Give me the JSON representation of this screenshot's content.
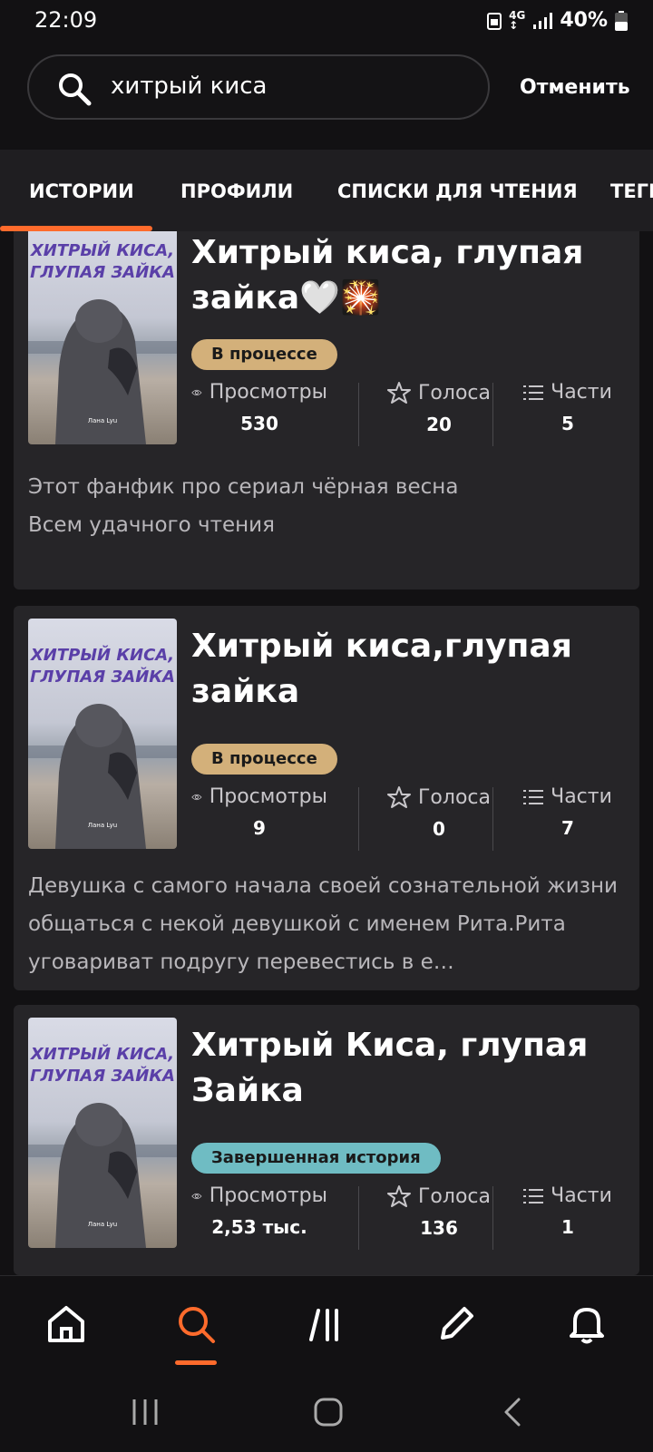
{
  "status_bar": {
    "time": "22:09",
    "network": "4G",
    "battery": "40%"
  },
  "search": {
    "query": "хитрый киса",
    "cancel_label": "Отменить"
  },
  "tabs": [
    {
      "label": "ИСТОРИИ",
      "active": true
    },
    {
      "label": "ПРОФИЛИ"
    },
    {
      "label": "СПИСКИ ДЛЯ ЧТЕНИЯ"
    },
    {
      "label": "ТЕГИ"
    }
  ],
  "stat_labels": {
    "views": "Просмотры",
    "votes": "Голоса",
    "parts": "Части"
  },
  "stories": [
    {
      "title": "Хитрый киса, глупая зайка🤍🎇",
      "status": "В процессе",
      "status_color": "#d3b07a",
      "views": "530",
      "votes": "20",
      "parts": "5",
      "description": "Этот фанфик про сериал чёрная весна\nВсем удачного чтения",
      "cover_title": "ХИТРЫЙ КИСА, ГЛУПАЯ ЗАЙКА",
      "cover_author": "Лана Lyu"
    },
    {
      "title": "Хитрый киса,глупая зайка",
      "status": "В процессе",
      "status_color": "#d3b07a",
      "views": "9",
      "votes": "0",
      "parts": "7",
      "description": "Девушка с самого начала своей сознательной жизни   общаться с некой девушкой с именем Рита.Рита уговариват подругу  перевестись в е…",
      "cover_title": "ХИТРЫЙ КИСА, ГЛУПАЯ ЗАЙКА",
      "cover_author": "Лана Lyu"
    },
    {
      "title": "Хитрый Киса, глупая Зайка",
      "status": "Завершенная история",
      "status_color": "#6fbcc3",
      "views": "2,53 тыс.",
      "votes": "136",
      "parts": "1",
      "description": "",
      "cover_title": "ХИТРЫЙ КИСА, ГЛУПАЯ ЗАЙКА",
      "cover_author": "Лана Lyu"
    }
  ],
  "bottom_nav": [
    {
      "name": "home-icon"
    },
    {
      "name": "search-icon",
      "active": true
    },
    {
      "name": "library-icon"
    },
    {
      "name": "write-icon"
    },
    {
      "name": "notifications-icon"
    }
  ],
  "accent_color": "#ff6b2c"
}
